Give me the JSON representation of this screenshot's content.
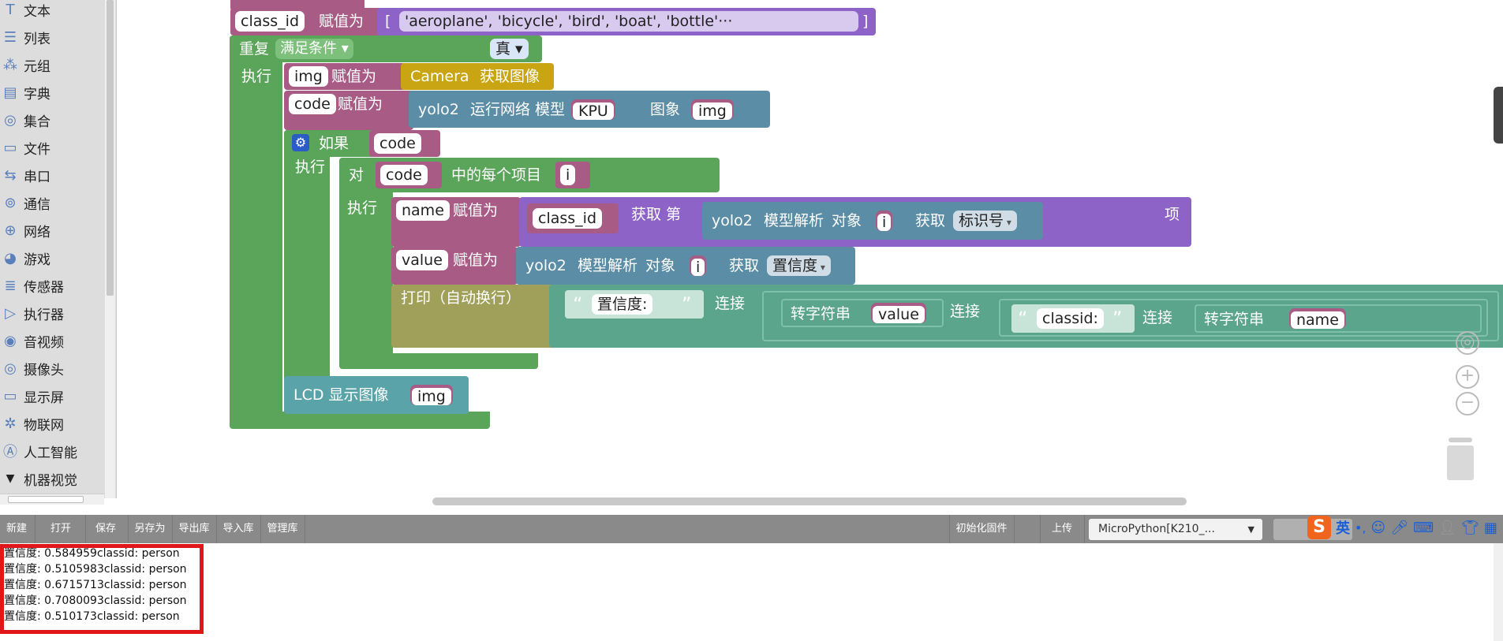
{
  "sidebar": {
    "categories": [
      {
        "label": "文本",
        "icon": "text-icon"
      },
      {
        "label": "列表",
        "icon": "list-icon"
      },
      {
        "label": "元组",
        "icon": "tuple-icon"
      },
      {
        "label": "字典",
        "icon": "dict-icon"
      },
      {
        "label": "集合",
        "icon": "set-icon"
      },
      {
        "label": "文件",
        "icon": "file-icon"
      },
      {
        "label": "串口",
        "icon": "serial-icon"
      },
      {
        "label": "通信",
        "icon": "signal-icon"
      },
      {
        "label": "网络",
        "icon": "globe-icon"
      },
      {
        "label": "游戏",
        "icon": "game-icon"
      },
      {
        "label": "传感器",
        "icon": "sensor-icon"
      },
      {
        "label": "执行器",
        "icon": "actuator-icon"
      },
      {
        "label": "音视频",
        "icon": "media-icon"
      },
      {
        "label": "摄像头",
        "icon": "camera-icon"
      },
      {
        "label": "显示屏",
        "icon": "display-icon"
      },
      {
        "label": "物联网",
        "icon": "iot-icon"
      },
      {
        "label": "人工智能",
        "icon": "ai-icon"
      },
      {
        "label": "机器视觉",
        "icon": "triangle-down-icon"
      }
    ]
  },
  "blocks": {
    "assign1": {
      "var": "class_id",
      "label": "赋值为",
      "list_open": "[",
      "list_items": "'aeroplane', 'bicycle', 'bird', 'boat', 'bottle'···",
      "list_close": "]"
    },
    "repeat": {
      "label": "重复",
      "mode": "满足条件",
      "cond": "真",
      "do": "执行"
    },
    "assign_img": {
      "var": "img",
      "label": "赋值为",
      "camera": "Camera",
      "get": "获取图像"
    },
    "assign_code": {
      "var": "code",
      "label": "赋值为",
      "yolo": "yolo2",
      "run": "运行网络",
      "model_label": "模型",
      "model": "KPU",
      "image_label": "图象",
      "image": "img"
    },
    "if": {
      "label": "如果",
      "cond": "code",
      "do": "执行"
    },
    "for": {
      "label": "对",
      "list": "code",
      "each": "中的每个项目",
      "item": "i",
      "do": "执行"
    },
    "assign_name": {
      "var": "name",
      "label": "赋值为",
      "list": "class_id",
      "get": "获取 第",
      "yolo": "yolo2",
      "parse": "模型解析",
      "obj": "对象",
      "item": "i",
      "get2": "获取",
      "field": "标识号",
      "suffix": "项"
    },
    "assign_value": {
      "var": "value",
      "label": "赋值为",
      "yolo": "yolo2",
      "parse": "模型解析",
      "obj": "对象",
      "item": "i",
      "get": "获取",
      "field": "置信度"
    },
    "print": {
      "label": "打印（自动换行）",
      "str1": "置信度:",
      "join1": "连接",
      "tostr1": "转字符串",
      "var1": "value",
      "join2": "连接",
      "str2": "classid:",
      "join3": "连接",
      "tostr2": "转字符串",
      "var2": "name"
    },
    "lcd": {
      "label": "LCD 显示图像",
      "img": "img"
    }
  },
  "toolbar": {
    "new": "新建",
    "open": "打开",
    "save": "保存",
    "save_as": "另存为",
    "export": "导出库",
    "import": "导入库",
    "manage": "管理库",
    "init_fw": "初始化固件",
    "upload": "上传",
    "board": "MicroPython[K210_..."
  },
  "ime": {
    "logo": "S",
    "lang": "英"
  },
  "console": {
    "lines": [
      "置信度:  0.584959classid: person",
      "置信度:  0.5105983classid: person",
      "置信度:  0.6715713classid: person",
      "置信度:  0.7080093classid: person",
      "置信度:  0.510173classid: person"
    ]
  },
  "colors": {
    "list_purple": "#8e63c7",
    "var_pink": "#a85b85",
    "loop_green": "#5ba55b",
    "camera_gold": "#c9a514",
    "ai_teal": "#5b8ea6",
    "text_teal": "#5ba58c",
    "highlight": "#e0161a"
  }
}
